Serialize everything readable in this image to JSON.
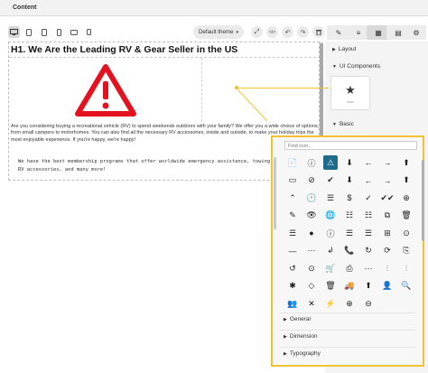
{
  "app": {
    "title": "Content"
  },
  "toolbar": {
    "theme_label": "Default theme",
    "theme_caret": "▾",
    "devices": [
      {
        "name": "desktop-icon",
        "glyph": "▭"
      },
      {
        "name": "tablet-icon",
        "glyph": "▯"
      },
      {
        "name": "tablet-small-icon",
        "glyph": "▯"
      },
      {
        "name": "phone-icon",
        "glyph": "▯"
      },
      {
        "name": "phone-landscape-icon",
        "glyph": "▭"
      },
      {
        "name": "phone-small-icon",
        "glyph": "▯"
      }
    ],
    "tools": [
      {
        "name": "fullscreen-icon",
        "glyph": "⤢"
      },
      {
        "name": "code-icon",
        "glyph": "</>"
      },
      {
        "name": "undo-icon",
        "glyph": "↶"
      },
      {
        "name": "redo-icon",
        "glyph": "↷"
      },
      {
        "name": "trash-icon",
        "glyph": "🗑"
      }
    ]
  },
  "right_tabs": [
    {
      "name": "style-manager-icon",
      "glyph": "✎"
    },
    {
      "name": "settings-list-icon",
      "glyph": "≡"
    },
    {
      "name": "blocks-grid-icon",
      "glyph": "▦"
    },
    {
      "name": "layers-icon",
      "glyph": "▤"
    },
    {
      "name": "gear-icon",
      "glyph": "⚙"
    }
  ],
  "canvas": {
    "heading": "H1. We Are the Leading RV & Gear Seller in the US",
    "paragraph": "Are you considering buying a recreational vehicle (RV) to spend weekends outdoors with your family? We offer you a wide choice of options, from small campers to motorhomes. You can also find all the necessary RV accessories, inside and outside, to make your holiday trips the most enjoyable experience. If you're happy, we're happy!",
    "mono_text": "We have the best membership programs that offer worldwide emergency assistance, towing, discounts on RV accessories, and many more!"
  },
  "panel": {
    "layout_label": "Layout",
    "ui_components_label": "UI Components",
    "icon_card_caption": "Icon",
    "basic_label": "Basic"
  },
  "icon_picker": {
    "search_placeholder": "Find icon...",
    "icons": [
      "📄",
      "ⓘ",
      "⚠",
      "⬇",
      "←",
      "→",
      "⬆",
      "▭",
      "⊘",
      "✔",
      "⬇",
      "←",
      "→",
      "⬆",
      "⌃",
      "🕒",
      "☰",
      "$",
      "✓",
      "✔✔",
      "⊕",
      "✎",
      "👁",
      "🌐",
      "☷",
      "☷",
      "⧉",
      "🗑",
      "☰",
      "●",
      "ⓘ",
      "☰",
      "☰",
      "⊞",
      "⊙",
      "—",
      "⋯",
      "↲",
      "📞",
      "↻",
      "⟳",
      "⎘",
      "↺",
      "⊙",
      "🛒",
      "⎙",
      "⋯",
      "⫶",
      "⫶",
      "✱",
      "◇",
      "🗑",
      "🚚",
      "⬆",
      "👤",
      "🔍",
      "👥",
      "✕",
      "⚡",
      "⊕",
      "⊖"
    ],
    "selected_index": 2,
    "accordions": [
      "General",
      "Dimension",
      "Typography"
    ]
  }
}
